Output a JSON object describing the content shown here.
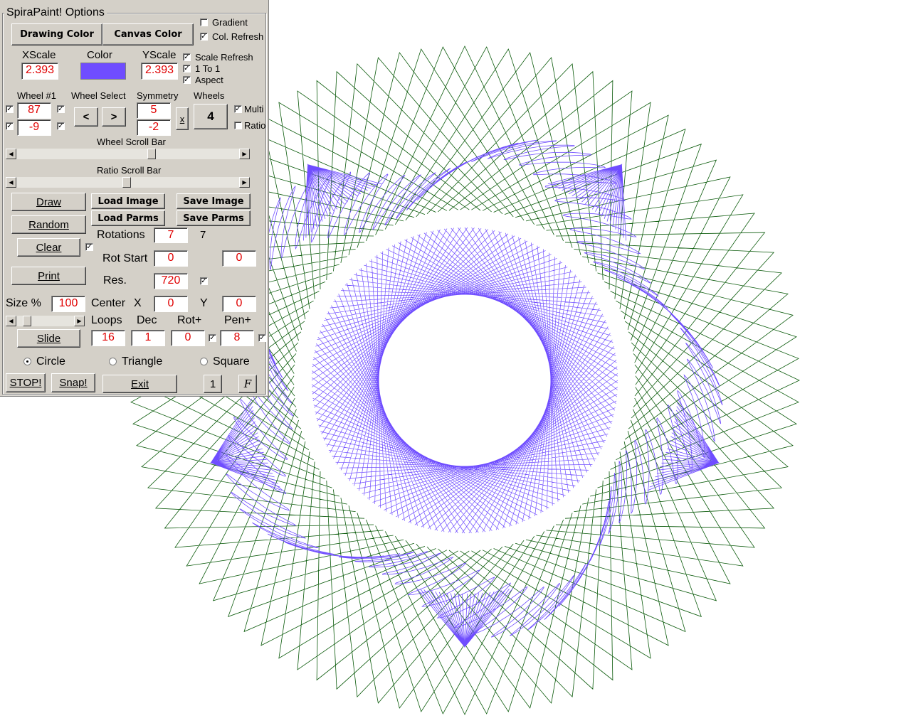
{
  "panel": {
    "title": "SpiraPaint! Options",
    "drawing_color_label": "Drawing Color",
    "canvas_color_label": "Canvas Color",
    "gradient_label": "Gradient",
    "col_refresh_label": "Col. Refresh",
    "xscale_label": "XScale",
    "color_label": "Color",
    "yscale_label": "YScale",
    "xscale_value": "2.393",
    "yscale_value": "2.393",
    "color_swatch": "#6f4dff",
    "scale_refresh_label": "Scale Refresh",
    "one_to_one_label": "1 To 1",
    "aspect_label": "Aspect",
    "wheel1_label": "Wheel #1",
    "wheel_select_label": "Wheel Select",
    "symmetry_label": "Symmetry",
    "wheels_label": "Wheels",
    "wheel1_value_a": "87",
    "wheel1_value_b": "-9",
    "prev_wheel": "<",
    "next_wheel": ">",
    "symmetry_value_a": "5",
    "symmetry_value_b": "-2",
    "x_button": "x",
    "wheels_count": "4",
    "multi_label": "Multi",
    "ratio_label": "Ratio",
    "wheel_scroll_label": "Wheel Scroll Bar",
    "ratio_scroll_label": "Ratio Scroll Bar",
    "draw_label": "Draw",
    "random_label": "Random",
    "clear_label": "Clear",
    "print_label": "Print",
    "load_image_label": "Load Image",
    "save_image_label": "Save Image",
    "load_parms_label": "Load Parms",
    "save_parms_label": "Save Parms",
    "rotations_label": "Rotations",
    "rotations_value": "7",
    "rotations_readout": "7",
    "rot_start_label": "Rot Start",
    "rot_start_value": "0",
    "rot_start_value2": "0",
    "res_label": "Res.",
    "res_value": "720",
    "size_label": "Size %",
    "size_value": "100",
    "center_label": "Center",
    "x_label": "X",
    "y_label": "Y",
    "center_x": "0",
    "center_y": "0",
    "loops_label": "Loops",
    "dec_label": "Dec",
    "rot_plus_label": "Rot+",
    "pen_plus_label": "Pen+",
    "loops_value": "16",
    "dec_value": "1",
    "rot_plus_value": "0",
    "pen_plus_value": "8",
    "slide_label": "Slide",
    "circle_label": "Circle",
    "triangle_label": "Triangle",
    "square_label": "Square",
    "stop_label": "STOP!",
    "snap_label": "Snap!",
    "exit_label": "Exit",
    "one_button": "1",
    "f_button": "F"
  },
  "drawing": {
    "outer_color": "#0a5a0a",
    "inner_color": "#6f4dff"
  }
}
